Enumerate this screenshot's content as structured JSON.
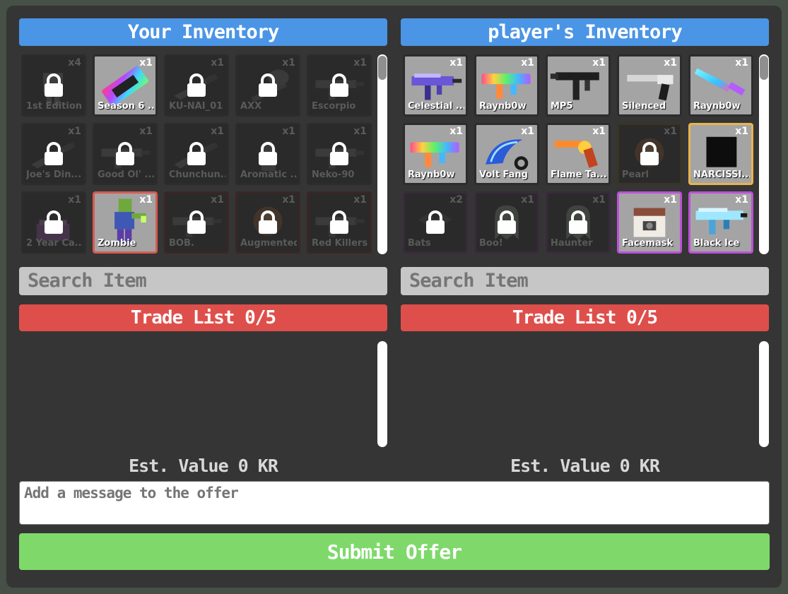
{
  "left": {
    "title": "Your Inventory",
    "search_placeholder": "Search Item",
    "trade_list": "Trade List 0/5",
    "est_value": "Est. Value 0 KR",
    "items": [
      {
        "name": "1st Edition",
        "qty": "x4",
        "locked": true,
        "rarity": "none",
        "art": "ribbon"
      },
      {
        "name": "Season 6 ...",
        "qty": "x1",
        "locked": false,
        "rarity": "none",
        "art": "ticket"
      },
      {
        "name": "KU-NAI_01",
        "qty": "x1",
        "locked": true,
        "rarity": "none",
        "art": "knife"
      },
      {
        "name": "AXX",
        "qty": "x1",
        "locked": true,
        "rarity": "none",
        "art": "axe"
      },
      {
        "name": "Escorpio",
        "qty": "x1",
        "locked": true,
        "rarity": "none",
        "art": "gun"
      },
      {
        "name": "Joe's Din...",
        "qty": "x1",
        "locked": true,
        "rarity": "none",
        "art": "knife"
      },
      {
        "name": "Good Ol' ...",
        "qty": "x1",
        "locked": true,
        "rarity": "none",
        "art": "gun"
      },
      {
        "name": "Chunchun...",
        "qty": "x1",
        "locked": true,
        "rarity": "none",
        "art": "knife"
      },
      {
        "name": "Aromatic ...",
        "qty": "x1",
        "locked": true,
        "rarity": "none",
        "art": "bottle"
      },
      {
        "name": "Neko-90",
        "qty": "x1",
        "locked": true,
        "rarity": "none",
        "art": "gun"
      },
      {
        "name": "2 Year Ca...",
        "qty": "x1",
        "locked": true,
        "rarity": "none",
        "art": "cake"
      },
      {
        "name": "Zombie",
        "qty": "x1",
        "locked": false,
        "rarity": "red",
        "art": "zombie"
      },
      {
        "name": "BOB.",
        "qty": "x1",
        "locked": true,
        "rarity": "red",
        "art": "gun"
      },
      {
        "name": "Augmented",
        "qty": "x1",
        "locked": true,
        "rarity": "red",
        "art": "orb"
      },
      {
        "name": "Red Killers",
        "qty": "x1",
        "locked": true,
        "rarity": "red",
        "art": "gun"
      }
    ]
  },
  "right": {
    "title": "player's Inventory",
    "search_placeholder": "Search Item",
    "trade_list": "Trade List 0/5",
    "est_value": "Est. Value 0 KR",
    "items": [
      {
        "name": "Celestial ...",
        "qty": "x1",
        "locked": false,
        "rarity": "none",
        "art": "smg-purple"
      },
      {
        "name": "Raynb0w",
        "qty": "x1",
        "locked": false,
        "rarity": "none",
        "art": "rifle-rainbow"
      },
      {
        "name": "MP5",
        "qty": "x1",
        "locked": false,
        "rarity": "none",
        "art": "smg-black"
      },
      {
        "name": "Silenced",
        "qty": "x1",
        "locked": false,
        "rarity": "none",
        "art": "pistol"
      },
      {
        "name": "Raynb0w",
        "qty": "x1",
        "locked": false,
        "rarity": "none",
        "art": "knife-rainbow"
      },
      {
        "name": "Raynb0w",
        "qty": "x1",
        "locked": false,
        "rarity": "none",
        "art": "rifle-rainbow"
      },
      {
        "name": "Volt Fang",
        "qty": "x1",
        "locked": false,
        "rarity": "none",
        "art": "karambit"
      },
      {
        "name": "Flame Ta...",
        "qty": "x1",
        "locked": false,
        "rarity": "none",
        "art": "revolver"
      },
      {
        "name": "Pearl",
        "qty": "x1",
        "locked": true,
        "rarity": "gold",
        "art": "orb"
      },
      {
        "name": "NARCISSI...",
        "qty": "x1",
        "locked": false,
        "rarity": "gold",
        "art": "black-box"
      },
      {
        "name": "Bats",
        "qty": "x2",
        "locked": true,
        "rarity": "purple",
        "art": "bats"
      },
      {
        "name": "Boo!",
        "qty": "x1",
        "locked": true,
        "rarity": "purple",
        "art": "ghost"
      },
      {
        "name": "Haunter",
        "qty": "x1",
        "locked": true,
        "rarity": "purple",
        "art": "ghost"
      },
      {
        "name": "Facemask",
        "qty": "x1",
        "locked": false,
        "rarity": "purple",
        "art": "facemask"
      },
      {
        "name": "Black Ice",
        "qty": "x1",
        "locked": false,
        "rarity": "purple",
        "art": "rifle-ice"
      }
    ]
  },
  "message_placeholder": "Add a message to the offer",
  "submit_label": "Submit Offer",
  "colors": {
    "header": "#4b95e6",
    "trade_list": "#de4f4b",
    "submit": "#7ed96a",
    "rarity_red": "#d85a52",
    "rarity_gold": "#e9b44c",
    "rarity_purple": "#bd51d8"
  }
}
